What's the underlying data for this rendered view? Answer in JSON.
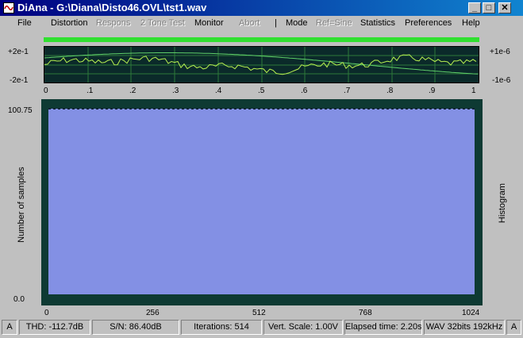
{
  "window": {
    "title": "DiAna - G:\\Diana\\Disto46.OVL\\tst1.wav",
    "min_glyph": "_",
    "max_glyph": "□",
    "close_glyph": "✕"
  },
  "menu": {
    "file": "File",
    "distortion": "Distortion",
    "respons": "Respons",
    "two_tone": "2 Tone Test",
    "monitor": "Monitor",
    "abort": "Abort",
    "separator": "|",
    "mode": "Mode",
    "ref_sine": "Ref=Sine",
    "statistics": "Statistics",
    "preferences": "Preferences",
    "help": "Help"
  },
  "scope": {
    "left_top": "+2e-1",
    "left_bottom": "-2e-1",
    "right_top": "+1e-6",
    "right_bottom": "-1e-6",
    "x_ticks": [
      "0",
      ".1",
      ".2",
      ".3",
      ".4",
      ".5",
      ".6",
      ".7",
      ".8",
      ".9",
      "1"
    ]
  },
  "histogram": {
    "y_max_label": "100.75",
    "y_min_label": "0.0",
    "y_axis_title": "Number of samples",
    "right_title": "Histogram",
    "x_ticks": [
      "0",
      "256",
      "512",
      "768",
      "1024"
    ]
  },
  "colors": {
    "fill": "#8390e4",
    "frame": "#0e3a33",
    "trace": "#b8f050",
    "grid": "#2e7a3a"
  },
  "status": {
    "left_a": "A",
    "thd": "THD: -112.7dB",
    "sn": "S/N:  86.40dB",
    "iterations": "Iterations: 514",
    "vscale": "Vert. Scale: 1.00V",
    "elapsed": "Elapsed time: 2.20s",
    "wav": "WAV 32bits 192kHz",
    "right_a": "A"
  }
}
